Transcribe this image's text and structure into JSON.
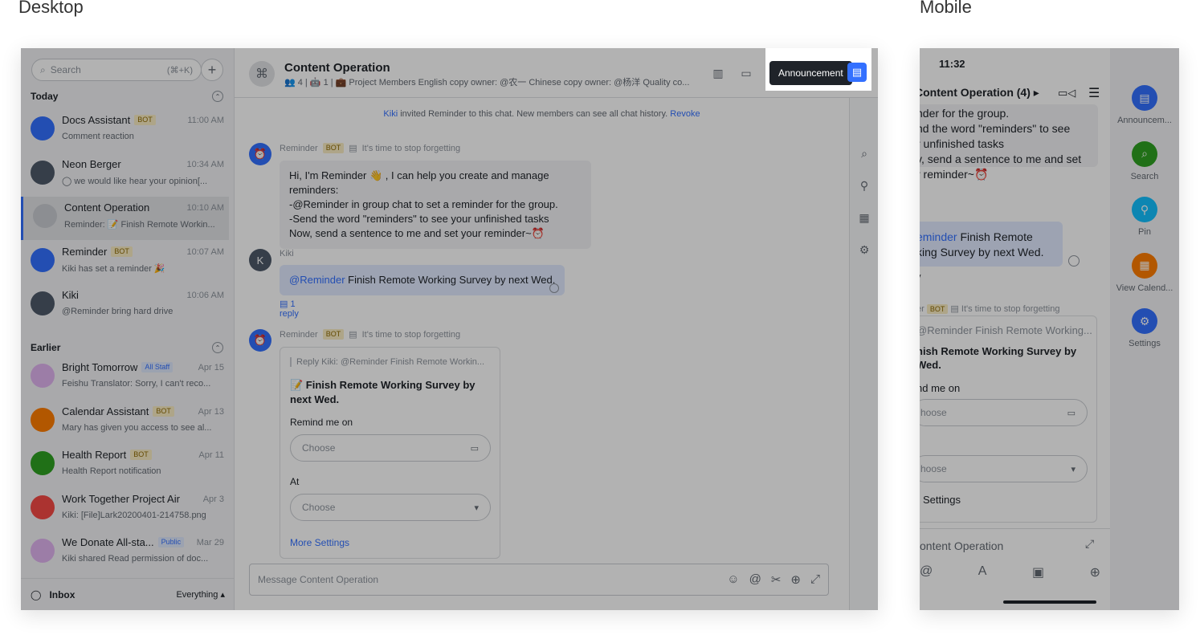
{
  "labels": {
    "desktop": "Desktop",
    "mobile": "Mobile"
  },
  "sidebar": {
    "search_placeholder": "Search",
    "search_shortcut": "(⌘+K)",
    "groups": [
      {
        "label": "Today",
        "items": [
          {
            "name": "Docs Assistant",
            "tag": "BOT",
            "time": "11:00 AM",
            "preview": "Comment reaction",
            "color": "#3370ff"
          },
          {
            "name": "Neon Berger",
            "tag": "",
            "time": "10:34 AM",
            "preview": "◯ we would like hear your opinion[...",
            "color": "#4e5969"
          },
          {
            "name": "Content Operation",
            "tag": "",
            "time": "10:10 AM",
            "preview": "Reminder: 📝 Finish Remote Workin...",
            "color": "#c9ccd1"
          },
          {
            "name": "Reminder",
            "tag": "BOT",
            "time": "10:07 AM",
            "preview": "Kiki has set a reminder 🎉",
            "color": "#3370ff"
          },
          {
            "name": "Kiki",
            "tag": "",
            "time": "10:06 AM",
            "preview": "@Reminder bring hard drive",
            "color": "#4e5969"
          }
        ]
      },
      {
        "label": "Earlier",
        "items": [
          {
            "name": "Bright Tomorrow",
            "tag": "All Staff",
            "time": "Apr 15",
            "preview": "Feishu Translator: Sorry, I can't reco...",
            "color": "#e0b3f0"
          },
          {
            "name": "Calendar Assistant",
            "tag": "BOT",
            "time": "Apr 13",
            "preview": "Mary has given you access to see al...",
            "color": "#ff7d00"
          },
          {
            "name": "Health Report",
            "tag": "BOT",
            "time": "Apr 11",
            "preview": "Health Report notification",
            "color": "#2ea121"
          },
          {
            "name": "Work Together Project Air",
            "tag": "",
            "time": "Apr 3",
            "preview": "Kiki: [File]Lark20200401-214758.png",
            "color": "#f54a45"
          },
          {
            "name": "We Donate All-sta...",
            "tag": "Public",
            "time": "Mar 29",
            "preview": "Kiki shared Read permission of doc...",
            "color": "#e0b3f0"
          }
        ]
      }
    ],
    "footer_inbox": "Inbox",
    "footer_filter": "Everything ▴"
  },
  "header": {
    "title": "Content Operation",
    "meta": "👥 4  |  🤖 1  |  💼 Project Members English copy owner: @农一 Chinese copy owner: @杨洋 Quality co...",
    "announcement_tooltip": "Announcement"
  },
  "system_message": {
    "user": "Kiki",
    "text": " invited Reminder to this chat. New members can see all chat history. ",
    "action": "Revoke"
  },
  "messages": [
    {
      "sender": "Reminder",
      "tag": "BOT",
      "note": "It's time to stop forgetting",
      "lines": [
        "Hi, I'm Reminder 👋 , I can help you create and manage reminders:",
        "-@Reminder in group chat to set a reminder for the group.",
        "-Send the word \"reminders\" to see your unfinished tasks",
        "Now, send a sentence to me and set your reminder~⏰"
      ]
    },
    {
      "sender": "Kiki",
      "mention": "@Reminder",
      "text": " Finish Remote Working Survey by next Wed.",
      "reply": "1 reply"
    },
    {
      "sender": "Reminder",
      "tag": "BOT",
      "note": "It's time to stop forgetting",
      "card": {
        "quote": "Reply Kiki:  @Reminder Finish Remote Workin...",
        "title": "📝 Finish Remote Working Survey by next Wed.",
        "remind_label": "Remind me on",
        "date_placeholder": "Choose",
        "at_label": "At",
        "time_placeholder": "Choose",
        "more": "More Settings"
      }
    }
  ],
  "composer": {
    "placeholder": "Message Content Operation"
  },
  "mobile": {
    "time": "11:32",
    "title": "Content Operation  (4) ▸",
    "lines_top": [
      "nder for the group.",
      "nd the word \"reminders\" to see",
      "r unfinished tasks",
      "y, send a sentence to me and set",
      "r reminder~⏰"
    ],
    "mention": "eminder",
    "blue_line1": " Finish Remote",
    "blue_line2": "king Survey by next Wed.",
    "reply": "y",
    "sender_line": "er",
    "sender_tag": "BOT",
    "sender_note": "It's time to stop forgetting",
    "card_quote": "@Reminder Finish Remote Working...",
    "card_title1": "nish Remote Working Survey by",
    "card_title2": "Wed.",
    "card_remind": "nd me on",
    "card_date": "hoose",
    "card_time": "hoose",
    "card_more": "Settings",
    "composer_placeholder": "ontent Operation",
    "rail": [
      {
        "label": "Announcem...",
        "color": "#3370ff",
        "icon": "▤"
      },
      {
        "label": "Search",
        "color": "#2ea121",
        "icon": "⌕"
      },
      {
        "label": "Pin",
        "color": "#14c0ff",
        "icon": "⚲"
      },
      {
        "label": "View Calend...",
        "color": "#ff7d00",
        "icon": "▦"
      },
      {
        "label": "Settings",
        "color": "#3370ff",
        "icon": "⚙"
      }
    ]
  }
}
